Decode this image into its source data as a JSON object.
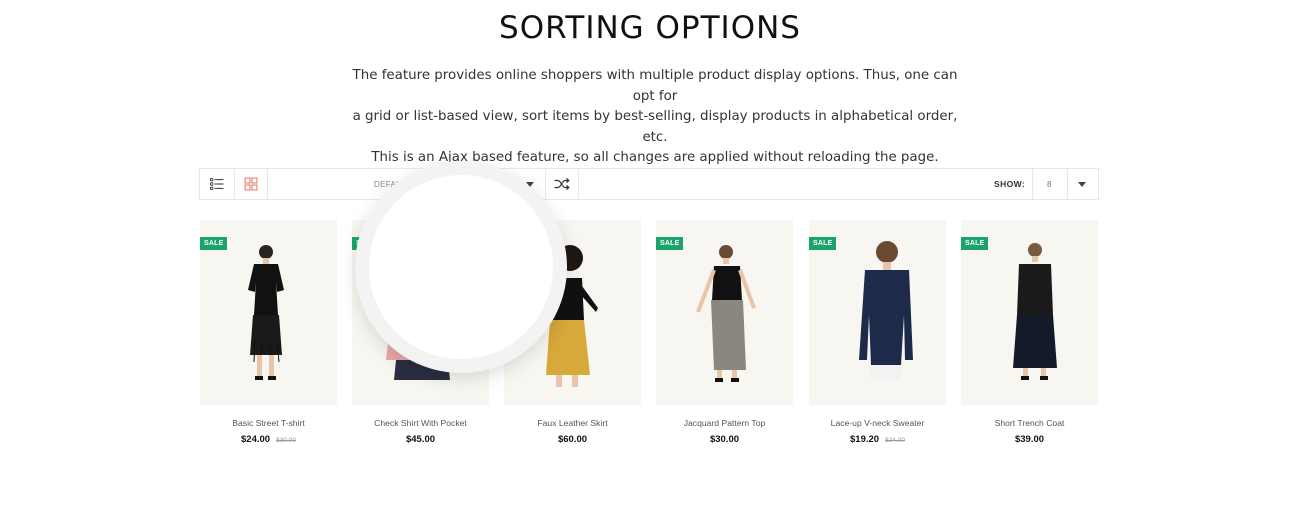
{
  "section": {
    "title": "SORTING OPTIONS",
    "description_lines": [
      "The feature provides online shoppers with multiple product display options. Thus, one can opt for",
      "a grid or list-based view, sort items by best-selling, display products in alphabetical order, etc.",
      "This is an Ajax based feature, so all changes are applied without reloading the page."
    ]
  },
  "toolbar": {
    "list_view_icon": "list-view-icon",
    "grid_view_icon": "grid-view-icon",
    "sort_value": "DEFAULT",
    "shuffle_icon": "shuffle-icon",
    "show_label": "SHOW:",
    "show_value": "8"
  },
  "colors": {
    "sale_badge": "#1aa46b",
    "active_icon": "#e8735e",
    "image_background": "#f8f6f1"
  },
  "products": [
    {
      "name": "Basic Street T-shirt",
      "price": "$24.00",
      "old_price": "$30.00",
      "badge": "SALE"
    },
    {
      "name": "Check Shirt With Pocket",
      "price": "$45.00",
      "old_price": "",
      "badge": "SALE"
    },
    {
      "name": "Faux Leather Skirt",
      "price": "$60.00",
      "old_price": "",
      "badge": ""
    },
    {
      "name": "Jacquard Pattern Top",
      "price": "$30.00",
      "old_price": "",
      "badge": "SALE"
    },
    {
      "name": "Lace-up V-neck Sweater",
      "price": "$19.20",
      "old_price": "$24.00",
      "badge": "SALE"
    },
    {
      "name": "Short Trench Coat",
      "price": "$39.00",
      "old_price": "",
      "badge": "SALE"
    }
  ]
}
